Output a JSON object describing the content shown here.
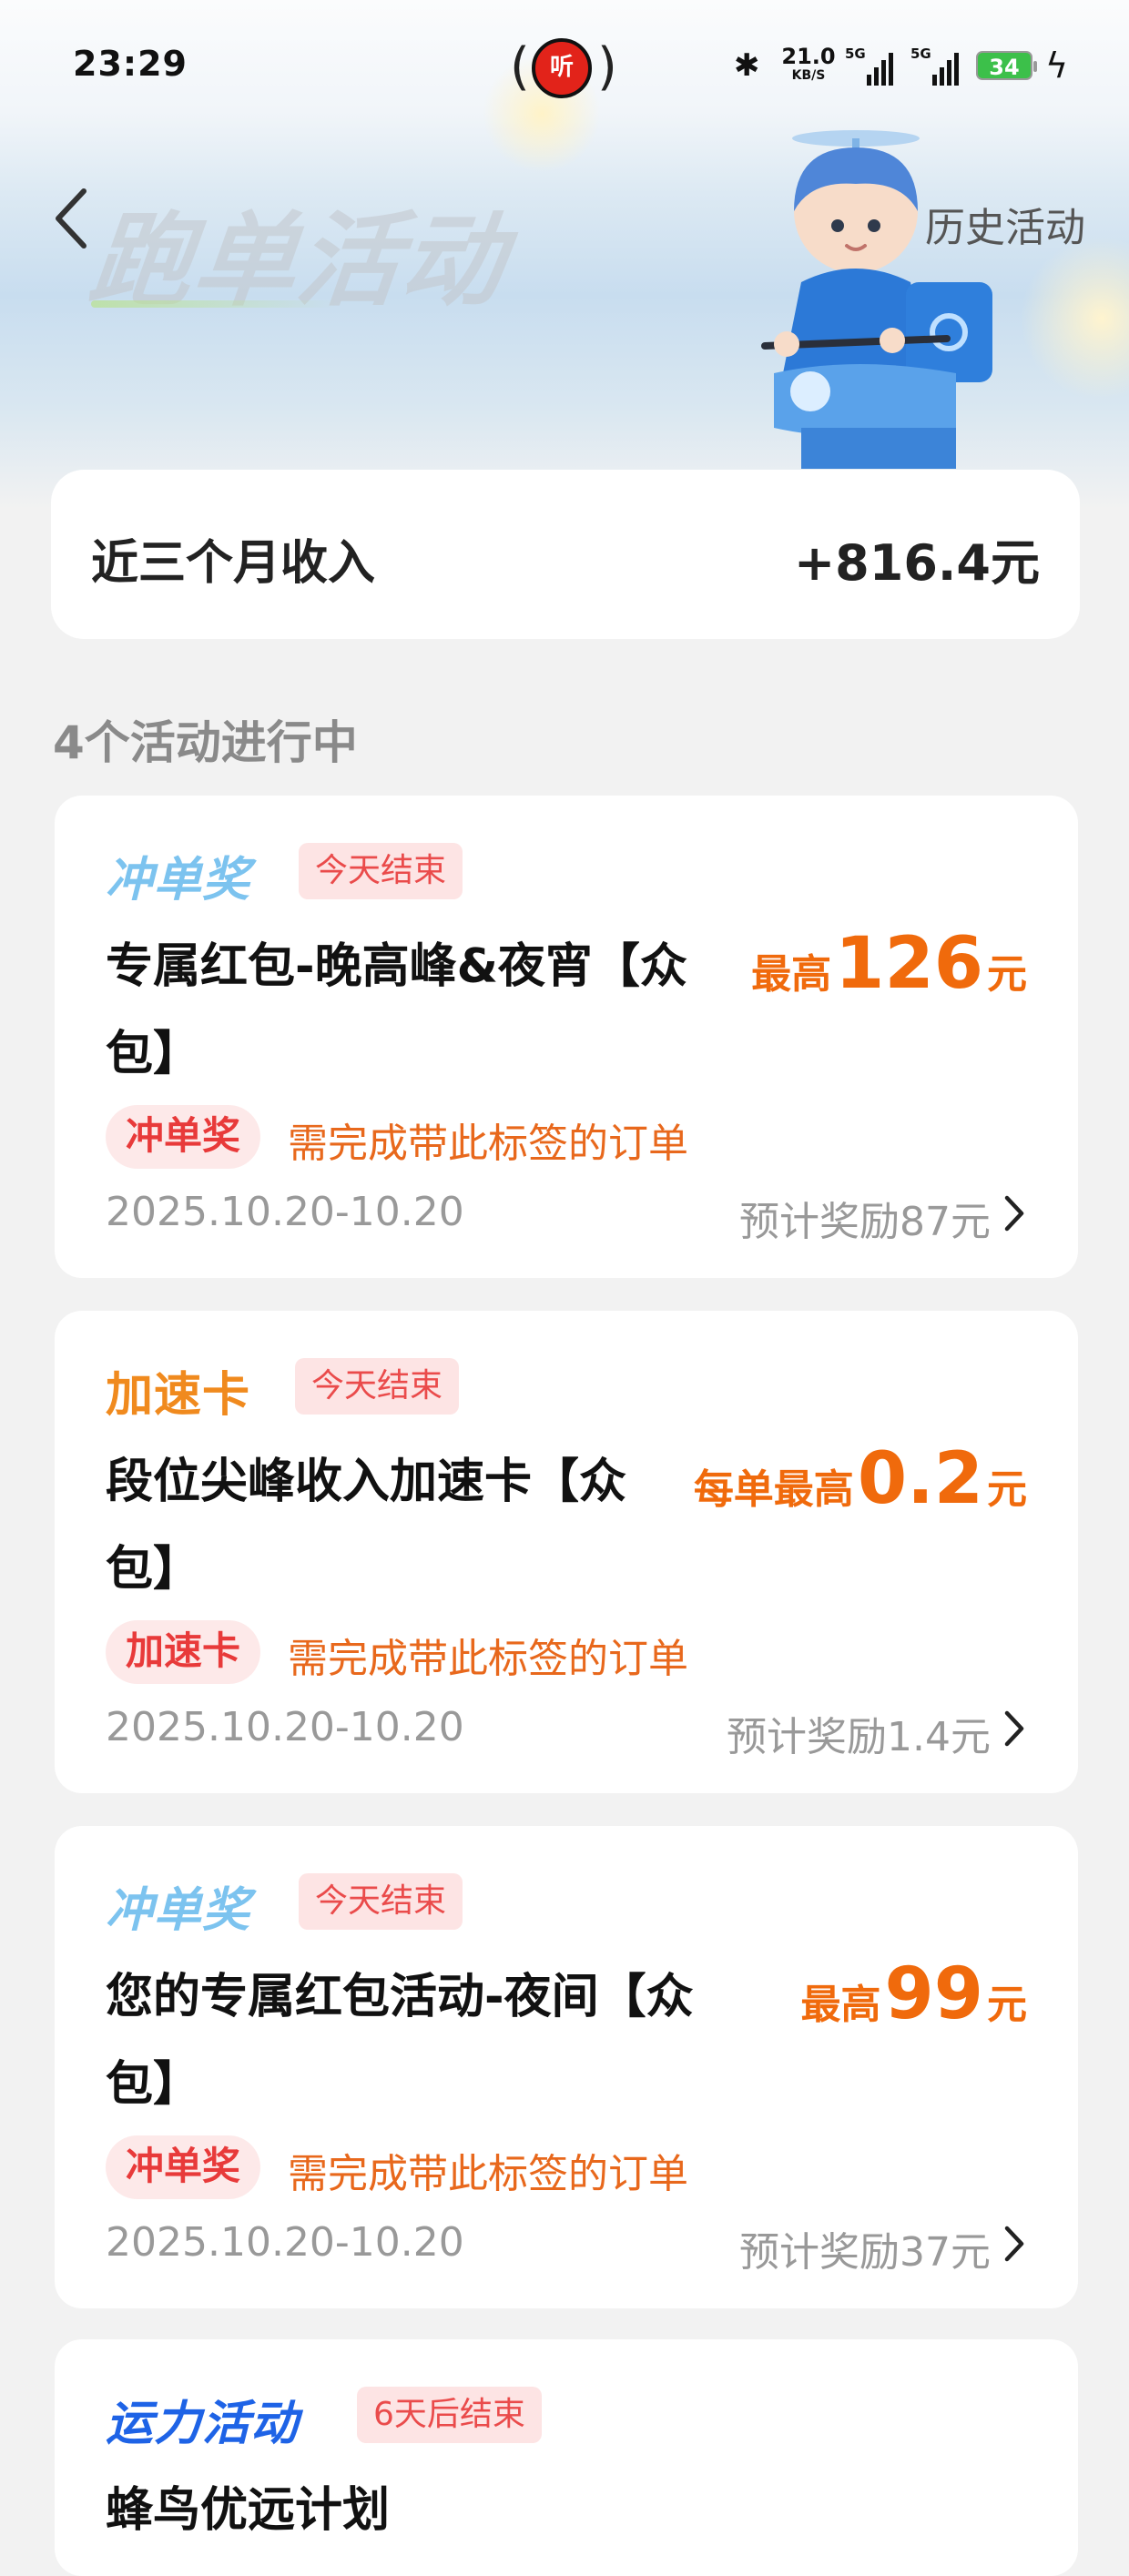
{
  "status_bar": {
    "time": "23:29",
    "center_badge_text": "听",
    "net_speed_value": "21.0",
    "net_speed_unit": "KB/S",
    "sim1_label": "5G",
    "sim2_label": "5G",
    "battery": "34",
    "icons": [
      "bluetooth-icon",
      "signal-icon",
      "battery-icon",
      "charging-icon"
    ]
  },
  "header": {
    "title": "跑单活动",
    "history_link": "历史活动"
  },
  "income": {
    "label": "近三个月收入",
    "value": "+816.4元"
  },
  "section_title": "4个活动进行中",
  "colors": {
    "accent_orange": "#f06a0c",
    "tag_red": "#ea4b4b",
    "logo_light_blue": "#7cc3ef",
    "logo_orange": "#f08a1e",
    "logo_blue": "#1e63e6"
  },
  "activities": [
    {
      "type_logo": "冲单奖",
      "end_tag": "今天结束",
      "title": "专属红包-晚高峰&夜宵【众包】",
      "reward_prefix": "最高",
      "reward_value": "126",
      "reward_unit": "元",
      "label_tag": "冲单奖",
      "requirement": "需完成带此标签的订单",
      "date_range": "2025.10.20-10.20",
      "estimate": "预计奖励87元"
    },
    {
      "type_logo": "加速卡",
      "end_tag": "今天结束",
      "title": "段位尖峰收入加速卡【众包】",
      "reward_prefix": "每单最高",
      "reward_value": "0.2",
      "reward_unit": "元",
      "label_tag": "加速卡",
      "requirement": "需完成带此标签的订单",
      "date_range": "2025.10.20-10.20",
      "estimate": "预计奖励1.4元"
    },
    {
      "type_logo": "冲单奖",
      "end_tag": "今天结束",
      "title": "您的专属红包活动-夜间【众包】",
      "reward_prefix": "最高",
      "reward_value": "99",
      "reward_unit": "元",
      "label_tag": "冲单奖",
      "requirement": "需完成带此标签的订单",
      "date_range": "2025.10.20-10.20",
      "estimate": "预计奖励37元"
    },
    {
      "type_logo": "运力活动",
      "end_tag": "6天后结束",
      "title": "蜂鸟优远计划"
    }
  ]
}
